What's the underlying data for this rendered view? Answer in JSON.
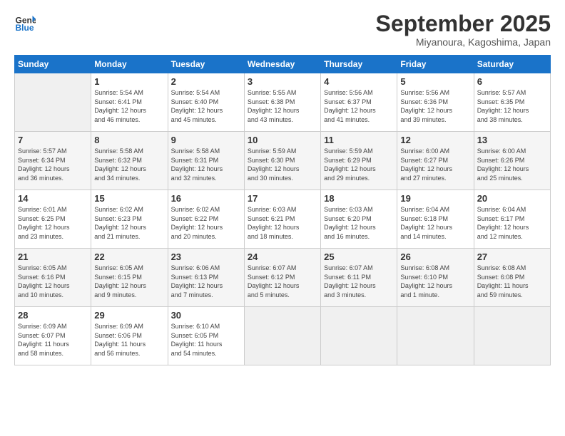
{
  "header": {
    "logo_line1": "General",
    "logo_line2": "Blue",
    "month": "September 2025",
    "location": "Miyanoura, Kagoshima, Japan"
  },
  "weekdays": [
    "Sunday",
    "Monday",
    "Tuesday",
    "Wednesday",
    "Thursday",
    "Friday",
    "Saturday"
  ],
  "weeks": [
    [
      {
        "day": "",
        "info": ""
      },
      {
        "day": "1",
        "info": "Sunrise: 5:54 AM\nSunset: 6:41 PM\nDaylight: 12 hours\nand 46 minutes."
      },
      {
        "day": "2",
        "info": "Sunrise: 5:54 AM\nSunset: 6:40 PM\nDaylight: 12 hours\nand 45 minutes."
      },
      {
        "day": "3",
        "info": "Sunrise: 5:55 AM\nSunset: 6:38 PM\nDaylight: 12 hours\nand 43 minutes."
      },
      {
        "day": "4",
        "info": "Sunrise: 5:56 AM\nSunset: 6:37 PM\nDaylight: 12 hours\nand 41 minutes."
      },
      {
        "day": "5",
        "info": "Sunrise: 5:56 AM\nSunset: 6:36 PM\nDaylight: 12 hours\nand 39 minutes."
      },
      {
        "day": "6",
        "info": "Sunrise: 5:57 AM\nSunset: 6:35 PM\nDaylight: 12 hours\nand 38 minutes."
      }
    ],
    [
      {
        "day": "7",
        "info": "Sunrise: 5:57 AM\nSunset: 6:34 PM\nDaylight: 12 hours\nand 36 minutes."
      },
      {
        "day": "8",
        "info": "Sunrise: 5:58 AM\nSunset: 6:32 PM\nDaylight: 12 hours\nand 34 minutes."
      },
      {
        "day": "9",
        "info": "Sunrise: 5:58 AM\nSunset: 6:31 PM\nDaylight: 12 hours\nand 32 minutes."
      },
      {
        "day": "10",
        "info": "Sunrise: 5:59 AM\nSunset: 6:30 PM\nDaylight: 12 hours\nand 30 minutes."
      },
      {
        "day": "11",
        "info": "Sunrise: 5:59 AM\nSunset: 6:29 PM\nDaylight: 12 hours\nand 29 minutes."
      },
      {
        "day": "12",
        "info": "Sunrise: 6:00 AM\nSunset: 6:27 PM\nDaylight: 12 hours\nand 27 minutes."
      },
      {
        "day": "13",
        "info": "Sunrise: 6:00 AM\nSunset: 6:26 PM\nDaylight: 12 hours\nand 25 minutes."
      }
    ],
    [
      {
        "day": "14",
        "info": "Sunrise: 6:01 AM\nSunset: 6:25 PM\nDaylight: 12 hours\nand 23 minutes."
      },
      {
        "day": "15",
        "info": "Sunrise: 6:02 AM\nSunset: 6:23 PM\nDaylight: 12 hours\nand 21 minutes."
      },
      {
        "day": "16",
        "info": "Sunrise: 6:02 AM\nSunset: 6:22 PM\nDaylight: 12 hours\nand 20 minutes."
      },
      {
        "day": "17",
        "info": "Sunrise: 6:03 AM\nSunset: 6:21 PM\nDaylight: 12 hours\nand 18 minutes."
      },
      {
        "day": "18",
        "info": "Sunrise: 6:03 AM\nSunset: 6:20 PM\nDaylight: 12 hours\nand 16 minutes."
      },
      {
        "day": "19",
        "info": "Sunrise: 6:04 AM\nSunset: 6:18 PM\nDaylight: 12 hours\nand 14 minutes."
      },
      {
        "day": "20",
        "info": "Sunrise: 6:04 AM\nSunset: 6:17 PM\nDaylight: 12 hours\nand 12 minutes."
      }
    ],
    [
      {
        "day": "21",
        "info": "Sunrise: 6:05 AM\nSunset: 6:16 PM\nDaylight: 12 hours\nand 10 minutes."
      },
      {
        "day": "22",
        "info": "Sunrise: 6:05 AM\nSunset: 6:15 PM\nDaylight: 12 hours\nand 9 minutes."
      },
      {
        "day": "23",
        "info": "Sunrise: 6:06 AM\nSunset: 6:13 PM\nDaylight: 12 hours\nand 7 minutes."
      },
      {
        "day": "24",
        "info": "Sunrise: 6:07 AM\nSunset: 6:12 PM\nDaylight: 12 hours\nand 5 minutes."
      },
      {
        "day": "25",
        "info": "Sunrise: 6:07 AM\nSunset: 6:11 PM\nDaylight: 12 hours\nand 3 minutes."
      },
      {
        "day": "26",
        "info": "Sunrise: 6:08 AM\nSunset: 6:10 PM\nDaylight: 12 hours\nand 1 minute."
      },
      {
        "day": "27",
        "info": "Sunrise: 6:08 AM\nSunset: 6:08 PM\nDaylight: 11 hours\nand 59 minutes."
      }
    ],
    [
      {
        "day": "28",
        "info": "Sunrise: 6:09 AM\nSunset: 6:07 PM\nDaylight: 11 hours\nand 58 minutes."
      },
      {
        "day": "29",
        "info": "Sunrise: 6:09 AM\nSunset: 6:06 PM\nDaylight: 11 hours\nand 56 minutes."
      },
      {
        "day": "30",
        "info": "Sunrise: 6:10 AM\nSunset: 6:05 PM\nDaylight: 11 hours\nand 54 minutes."
      },
      {
        "day": "",
        "info": ""
      },
      {
        "day": "",
        "info": ""
      },
      {
        "day": "",
        "info": ""
      },
      {
        "day": "",
        "info": ""
      }
    ]
  ]
}
